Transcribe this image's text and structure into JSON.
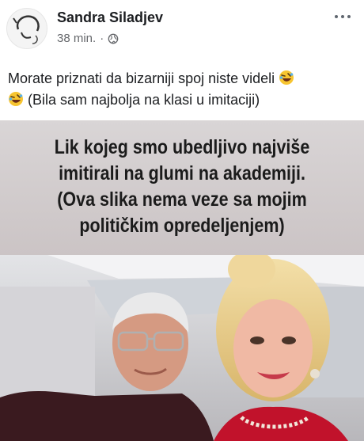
{
  "post": {
    "author": "Sandra Siladjev",
    "time": "38 min.",
    "separator": "·",
    "caption_line1": "Morate priznati da bizarniji spoj niste videli",
    "caption_line2": "(Bila sam najbolja na klasi u imitaciji)",
    "emojis": [
      "rolling-on-floor-laughing-emoji",
      "rolling-on-floor-laughing-emoji"
    ]
  },
  "image": {
    "banner_lines": [
      "Lik kojeg smo ubedljivo najviše",
      "imitirali na glumi na akademiji.",
      "(Ova slika nema veze sa mojim",
      "političkim opredeljenjem)"
    ]
  },
  "icons": {
    "more": "more-options-icon",
    "privacy": "globe-icon"
  },
  "colors": {
    "name": "#1c1e21",
    "meta": "#65676b",
    "banner_bg": "#d2cccd"
  }
}
